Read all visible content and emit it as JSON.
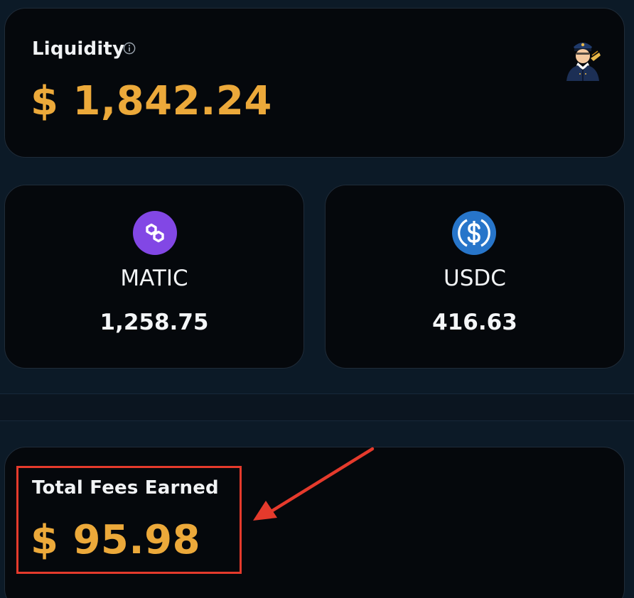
{
  "liquidity": {
    "label": "Liquidity",
    "amount": "$ 1,842.24"
  },
  "tokens": [
    {
      "name": "MATIC",
      "amount": "1,258.75",
      "icon": "polygon-icon",
      "color": "#8247e5"
    },
    {
      "name": "USDC",
      "amount": "416.63",
      "icon": "usdc-icon",
      "color": "#2775ca"
    }
  ],
  "fees": {
    "label": "Total Fees Earned",
    "amount": "$ 95.98"
  },
  "colors": {
    "accent": "#eca93a",
    "highlight": "#e53a2c",
    "card_bg": "#05080c",
    "page_bg": "#0b1520"
  }
}
